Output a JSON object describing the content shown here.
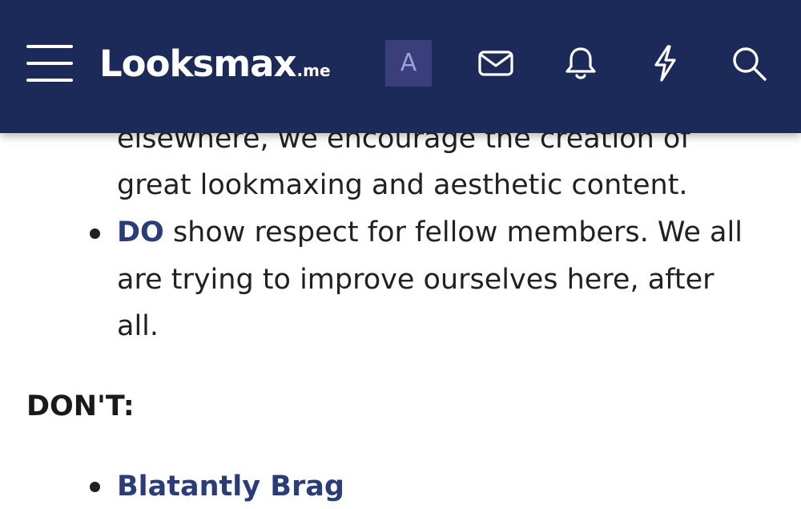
{
  "header": {
    "logo_main": "Looksmax",
    "logo_suffix": ".me",
    "avatar_letter": "A",
    "icons": [
      "menu-icon",
      "mail-icon",
      "bell-icon",
      "bolt-icon",
      "search-icon"
    ],
    "background_color": "#1c2a59"
  },
  "rules": {
    "cut_off_line": "elsewhere, we encourage the creation of",
    "line_2": "great lookmaxing and aesthetic content.",
    "do_item": {
      "keyword": "DO",
      "line_1_rest": " show respect for fellow members. We all",
      "line_2": "are trying to improve ourselves here, after",
      "line_3": "all."
    },
    "dont_heading": "DON'T:",
    "dont_first_item": "Blatantly Brag",
    "link_color": "#2b3d78"
  }
}
